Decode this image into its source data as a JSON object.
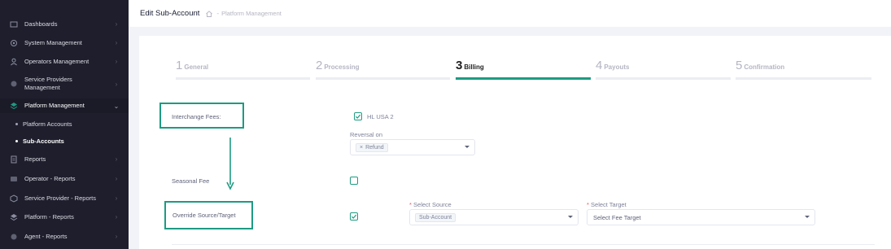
{
  "sidebar": {
    "items": [
      {
        "label": "Dashboards",
        "icon": "dashboard-icon"
      },
      {
        "label": "System Management",
        "icon": "settings-icon"
      },
      {
        "label": "Operators Management",
        "icon": "user-icon"
      },
      {
        "label": "Service Providers Management",
        "icon": "provider-icon"
      },
      {
        "label": "Platform Management",
        "icon": "layers-icon"
      },
      {
        "label": "Reports",
        "icon": "report-icon"
      },
      {
        "label": "Operator - Reports",
        "icon": "operator-report-icon"
      },
      {
        "label": "Service Provider - Reports",
        "icon": "cube-icon"
      },
      {
        "label": "Platform - Reports",
        "icon": "stack-icon"
      },
      {
        "label": "Agent - Reports",
        "icon": "agent-icon"
      }
    ],
    "sub_items": [
      {
        "label": "Platform Accounts"
      },
      {
        "label": "Sub-Accounts"
      }
    ]
  },
  "header": {
    "title": "Edit Sub-Account",
    "breadcrumb_separator": "-",
    "breadcrumb": "Platform Management"
  },
  "steps": [
    {
      "num": "1",
      "label": "General"
    },
    {
      "num": "2",
      "label": "Processing"
    },
    {
      "num": "3",
      "label": "Billing"
    },
    {
      "num": "4",
      "label": "Payouts"
    },
    {
      "num": "5",
      "label": "Confirmation"
    }
  ],
  "active_step": "3",
  "form": {
    "interchange_label": "Interchange Fees:",
    "hl_usa_label": "HL USA 2",
    "hl_usa_checked": true,
    "reversal_label": "Reversal on",
    "reversal_tag": "Refund",
    "reversal_tag_remove": "×",
    "seasonal_label": "Seasonal Fee",
    "seasonal_checked": false,
    "override_label": "Override Source/Target",
    "override_checked": true,
    "required_mark": "*",
    "select_source_label": "Select Source",
    "select_source_value": "Sub-Account",
    "select_target_label": "Select Target",
    "select_target_placeholder": "Select Fee Target"
  },
  "colors": {
    "accent": "#1d9b82",
    "sidebar_bg": "#1e1e2d",
    "page_bg": "#f2f3f8"
  }
}
